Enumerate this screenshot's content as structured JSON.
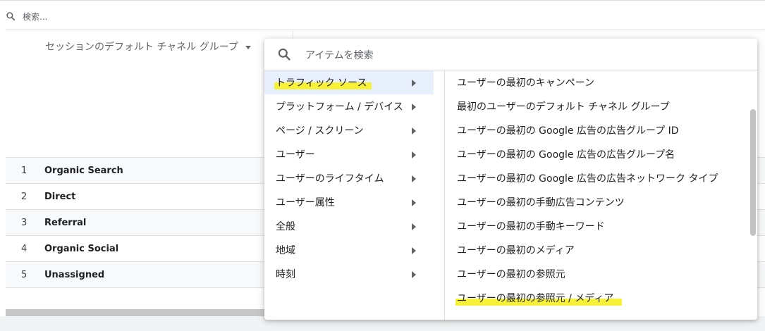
{
  "report": {
    "search_placeholder": "検索...",
    "dimension_header": "セッションのデフォルト チャネル グループ",
    "rows": [
      {
        "index": "1",
        "name": "Organic Search"
      },
      {
        "index": "2",
        "name": "Direct"
      },
      {
        "index": "3",
        "name": "Referral"
      },
      {
        "index": "4",
        "name": "Organic Social"
      },
      {
        "index": "5",
        "name": "Unassigned"
      }
    ]
  },
  "popup": {
    "search_placeholder": "アイテムを検索",
    "categories": [
      {
        "label": "トラフィック ソース",
        "active": true
      },
      {
        "label": "プラットフォーム / デバイス"
      },
      {
        "label": "ページ / スクリーン"
      },
      {
        "label": "ユーザー"
      },
      {
        "label": "ユーザーのライフタイム"
      },
      {
        "label": "ユーザー属性"
      },
      {
        "label": "全般"
      },
      {
        "label": "地域"
      },
      {
        "label": "時刻"
      }
    ],
    "items": [
      "ユーザーの最初のキャンペーン",
      "最初のユーザーのデフォルト チャネル グループ",
      "ユーザーの最初の Google 広告の広告グループ ID",
      "ユーザーの最初の Google 広告の広告グループ名",
      "ユーザーの最初の Google 広告の広告ネットワーク タイプ",
      "ユーザーの最初の手動広告コンテンツ",
      "ユーザーの最初の手動キーワード",
      "ユーザーの最初のメディア",
      "ユーザーの最初の参照元",
      "ユーザーの最初の参照元 / メディア"
    ]
  },
  "colors": {
    "highlight": "#f7f238",
    "active_category_bg": "#e8f0fe"
  }
}
